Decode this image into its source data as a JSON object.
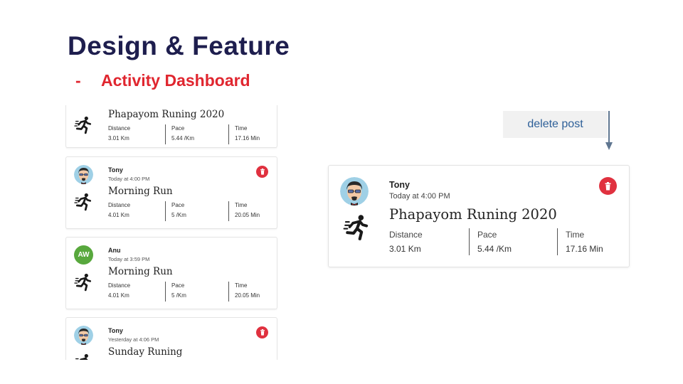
{
  "slide": {
    "title": "Design & Feature",
    "subtitle_dash": "-",
    "subtitle": "Activity Dashboard",
    "accent_color": "#e0262f",
    "title_color": "#1e1e4e"
  },
  "feed": {
    "cards": [
      {
        "user": "",
        "time": "",
        "avatar": "none",
        "title": "Phapayom Runing 2020",
        "stats": [
          {
            "label": "Distance",
            "value": "3.01 Km"
          },
          {
            "label": "Pace",
            "value": "5.44 /Km"
          },
          {
            "label": "Time",
            "value": "17.16 Min"
          }
        ],
        "deletable": false
      },
      {
        "user": "Tony",
        "time": "Today at 4:00 PM",
        "avatar": "cartoon-face",
        "title": "Morning Run",
        "stats": [
          {
            "label": "Distance",
            "value": "4.01 Km"
          },
          {
            "label": "Pace",
            "value": "5 /Km"
          },
          {
            "label": "Time",
            "value": "20.05 Min"
          }
        ],
        "deletable": true
      },
      {
        "user": "Anu",
        "time": "Today at 3:59 PM",
        "avatar": "initials",
        "initials": "AW",
        "avatar_color": "#58a83d",
        "title": "Morning Run",
        "stats": [
          {
            "label": "Distance",
            "value": "4.01 Km"
          },
          {
            "label": "Pace",
            "value": "5 /Km"
          },
          {
            "label": "Time",
            "value": "20.05 Min"
          }
        ],
        "deletable": false
      },
      {
        "user": "Tony",
        "time": "Yesterday at 4:06 PM",
        "avatar": "cartoon-face",
        "title": "Sunday Runing",
        "deletable": true
      }
    ]
  },
  "detail": {
    "user": "Tony",
    "time": "Today at 4:00 PM",
    "title": "Phapayom Runing 2020",
    "stats": [
      {
        "label": "Distance",
        "value": "3.01 Km"
      },
      {
        "label": "Pace",
        "value": "5.44 /Km"
      },
      {
        "label": "Time",
        "value": "17.16 Min"
      }
    ],
    "delete_color": "#e0313f"
  },
  "callout": {
    "text": "delete post"
  },
  "icons": {
    "activity": "runner-icon",
    "delete": "trash-icon"
  }
}
